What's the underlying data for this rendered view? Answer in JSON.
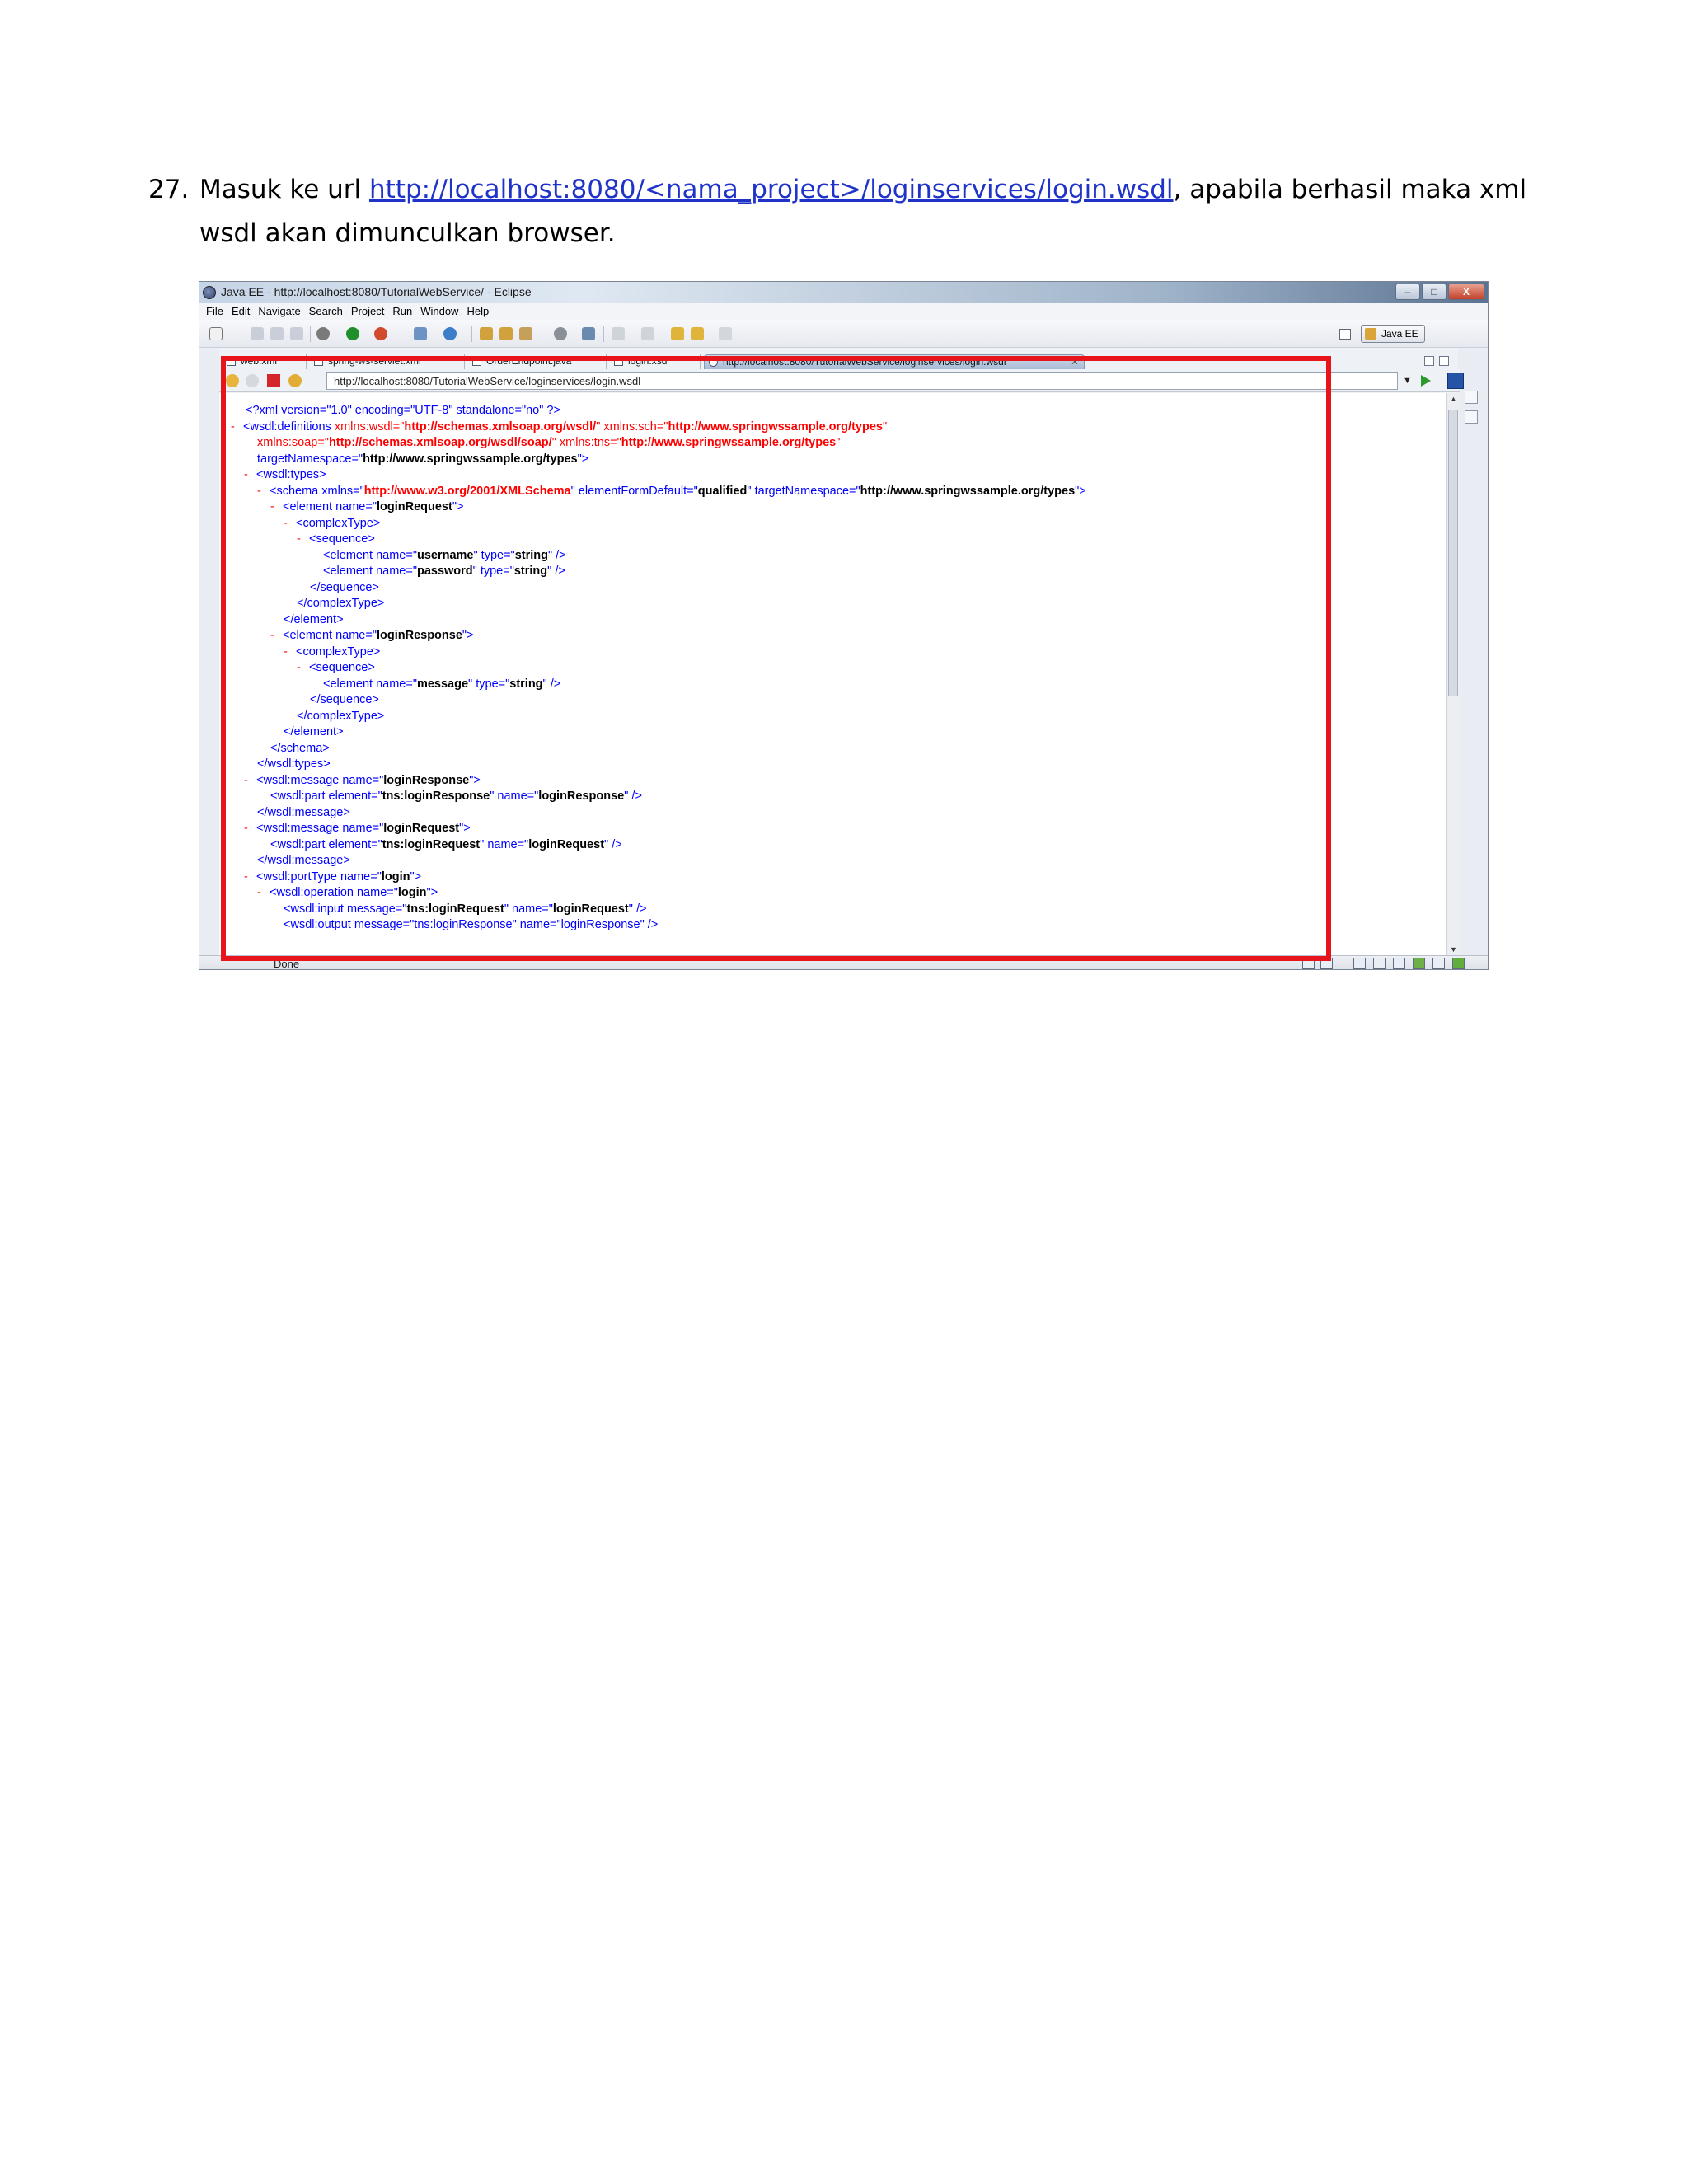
{
  "instruction": {
    "number": "27.",
    "prefix": "Masuk ke url ",
    "link_text": "http://localhost:8080/<nama_project>/loginservices/login.wsdl",
    "suffix": ", apabila berhasil maka xml wsdl akan dimunculkan browser."
  },
  "window": {
    "title": "Java EE - http://localhost:8080/TutorialWebService/ - Eclipse",
    "controls": {
      "minimize": "–",
      "maximize": "□",
      "close": "X"
    }
  },
  "menu": [
    "File",
    "Edit",
    "Navigate",
    "Search",
    "Project",
    "Run",
    "Window",
    "Help"
  ],
  "perspective": {
    "label": "Java EE"
  },
  "tabs": [
    {
      "label": "web.xml"
    },
    {
      "label": "spring-ws-servlet.xml"
    },
    {
      "label": "OrderEndpoint.java"
    },
    {
      "label": "login.xsd"
    },
    {
      "label": "http://localhost:8080/TutorialWebService/loginservices/login.wsdl",
      "active": true,
      "close": "✕"
    }
  ],
  "browser": {
    "url": "http://localhost:8080/TutorialWebService/loginservices/login.wsdl",
    "status": "Done"
  },
  "xml": {
    "decl": "<?xml version=\"1.0\" encoding=\"UTF-8\" standalone=\"no\" ?>",
    "toggle": "-",
    "definitions": {
      "open": "<wsdl:definitions",
      "xmlns_wsdl_attr": "xmlns:wsdl=\"",
      "xmlns_wsdl_val": "http://schemas.xmlsoap.org/wsdl/",
      "xmlns_sch_attr": "\" xmlns:sch=\"",
      "xmlns_sch_val": "http://www.springwssample.org/types",
      "xmlns_soap_attr": "xmlns:soap=\"",
      "xmlns_soap_val": "http://schemas.xmlsoap.org/wsdl/soap/",
      "xmlns_tns_attr": "\" xmlns:tns=\"",
      "xmlns_tns_val": "http://www.springwssample.org/types",
      "target_attr": "targetNamespace=\"",
      "target_val": "http://www.springwssample.org/types",
      "quote_close": "\"",
      "quote_gt": "\">"
    },
    "types_open": "<wsdl:types>",
    "schema": {
      "open": "<schema xmlns=\"",
      "xmlns_val": "http://www.w3.org/2001/XMLSchema",
      "efd_attr": "\" elementFormDefault=\"",
      "efd_val": "qualified",
      "tns_attr": "\" targetNamespace=\"",
      "tns_val": "http://www.springwssample.org/types",
      "end": "\">"
    },
    "el_login_request_open": "<element name=\"",
    "name_login_request": "loginRequest",
    "name_login_response": "loginResponse",
    "complex_open": "<complexType>",
    "sequence_open": "<sequence>",
    "el_name_prefix": "<element name=\"",
    "type_attr": "\" type=\"",
    "type_string": "string",
    "self_close": "\" />",
    "username": "username",
    "password": "password",
    "message": "message",
    "sequence_close": "</sequence>",
    "complex_close": "</complexType>",
    "element_close": "</element>",
    "schema_close": "</schema>",
    "types_close": "</wsdl:types>",
    "msg_open": "<wsdl:message name=\"",
    "part_open": "<wsdl:part element=\"",
    "tns_login_response": "tns:loginResponse",
    "tns_login_request": "tns:loginRequest",
    "name_attr": "\" name=\"",
    "msg_close": "</wsdl:message>",
    "porttype_open": "<wsdl:portType name=\"",
    "login": "login",
    "operation_open": "<wsdl:operation name=\"",
    "input_open": "<wsdl:input message=\"",
    "output_partial": "<wsdl:output message=\"tns:loginResponse\" name=\"loginResponse\" />"
  },
  "icons": [
    "eclipse-app-icon",
    "new-icon",
    "save-icon",
    "run-icon",
    "debug-icon",
    "back-icon",
    "forward-icon",
    "stop-icon",
    "refresh-icon",
    "go-icon",
    "perspective-icon"
  ],
  "colors": {
    "highlight": "#e8141c",
    "link": "#1f33c9",
    "xml_tag": "#0000ff",
    "xml_attr_value": "#ff0000"
  }
}
